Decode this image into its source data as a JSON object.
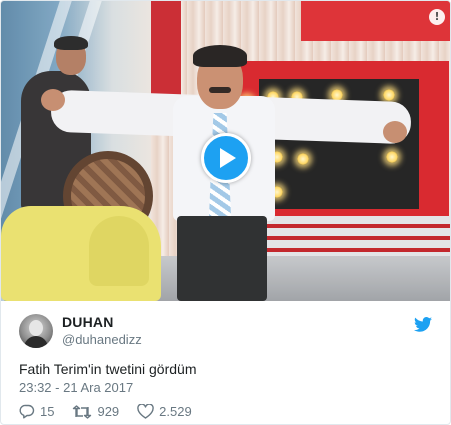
{
  "video": {
    "play_icon": "play-icon",
    "info_icon": "info-icon",
    "info_glyph": "!"
  },
  "author": {
    "display_name": "DUHAN",
    "handle": "@duhanedizz"
  },
  "tweet": {
    "text": "Fatih Terim'in twetini gördüm",
    "timestamp": "23:32 - 21 Ara 2017"
  },
  "actions": {
    "replies": "15",
    "retweets": "929",
    "likes": "2.529"
  },
  "colors": {
    "twitter_blue": "#1da1f2",
    "text_primary": "#1c2022",
    "text_secondary": "#697882"
  }
}
